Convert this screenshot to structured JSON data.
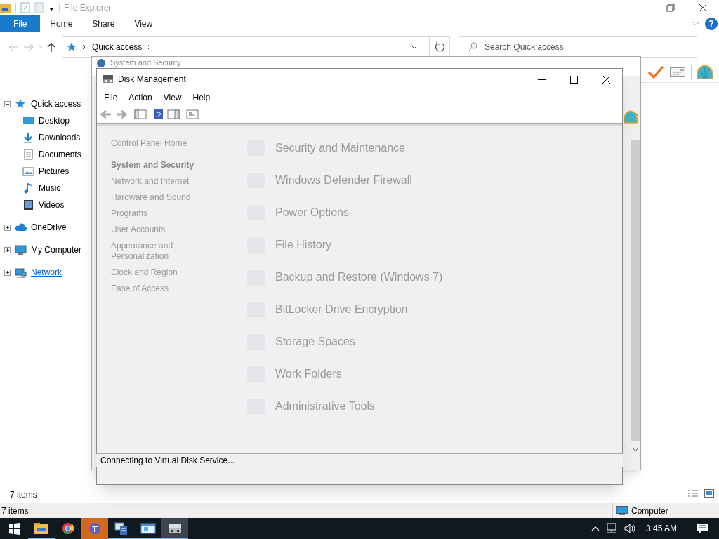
{
  "explorer": {
    "title": "File Explorer",
    "ribbon_tabs": [
      {
        "label": "File",
        "selected": true
      },
      {
        "label": "Home",
        "selected": false
      },
      {
        "label": "Share",
        "selected": false
      },
      {
        "label": "View",
        "selected": false
      }
    ],
    "address": "Quick access",
    "search": {
      "placeholder": "Search Quick access"
    },
    "nav": [
      {
        "label": "Quick access",
        "kind": "star",
        "expanded": true,
        "hovered": false,
        "children": [
          {
            "label": "Desktop",
            "kind": "desktop",
            "hovered": false
          },
          {
            "label": "Downloads",
            "kind": "download",
            "hovered": false
          },
          {
            "label": "Documents",
            "kind": "document",
            "hovered": false
          },
          {
            "label": "Pictures",
            "kind": "pictures",
            "hovered": false
          },
          {
            "label": "Music",
            "kind": "music",
            "hovered": false
          },
          {
            "label": "Videos",
            "kind": "videos",
            "hovered": false
          }
        ]
      },
      {
        "label": "OneDrive",
        "kind": "cloud",
        "expanded": false,
        "hovered": false
      },
      {
        "label": "My Computer",
        "kind": "computer",
        "expanded": false,
        "hovered": false
      },
      {
        "label": "Network",
        "kind": "network",
        "expanded": false,
        "hovered": true
      }
    ],
    "help": "?",
    "status": "7 items"
  },
  "back_window": {
    "title": "System and Security",
    "sidebar": [
      {
        "label": "Control Panel Home",
        "selected": false
      },
      {
        "label": "System and Security",
        "selected": true
      },
      {
        "label": "Network and Internet",
        "selected": false
      },
      {
        "label": "Hardware and Sound",
        "selected": false
      },
      {
        "label": "Programs",
        "selected": false
      },
      {
        "label": "User Accounts",
        "selected": false
      },
      {
        "label": "Appearance and Personalization",
        "selected": false
      },
      {
        "label": "Clock and Region",
        "selected": false
      },
      {
        "label": "Ease of Access",
        "selected": false
      }
    ],
    "sections": [
      "Security and Maintenance",
      "Windows Defender Firewall",
      "Power Options",
      "File History",
      "Backup and Restore (Windows 7)",
      "BitLocker Drive Encryption",
      "Storage Spaces",
      "Work Folders",
      "Administrative Tools"
    ]
  },
  "disk_management": {
    "title": "Disk Management",
    "menu": [
      "File",
      "Action",
      "View",
      "Help"
    ],
    "status": "Connecting to Virtual Disk Service..."
  },
  "second_window_status": {
    "items": "7 items",
    "location": "Computer"
  },
  "taskbar": {
    "apps": [
      {
        "kind": "folder",
        "running": true,
        "attention": false,
        "selected": false
      },
      {
        "kind": "chrome",
        "running": false,
        "attention": false,
        "selected": false
      },
      {
        "kind": "teams",
        "running": false,
        "attention": true,
        "selected": false
      },
      {
        "kind": "server",
        "running": true,
        "attention": false,
        "selected": false
      },
      {
        "kind": "console",
        "running": true,
        "attention": false,
        "selected": false
      },
      {
        "kind": "disk",
        "running": true,
        "attention": false,
        "selected": true
      }
    ],
    "clock": "3:45 AM"
  }
}
